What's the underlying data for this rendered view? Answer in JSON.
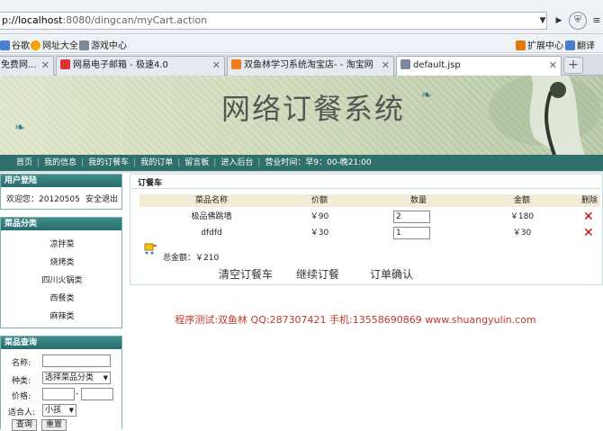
{
  "browser": {
    "address": {
      "prefix": "p://",
      "host": "localhost",
      "rest": ":8080/dingcan/myCart.action"
    },
    "bookmarks": [
      {
        "label": "谷歌",
        "color": "#4a7fd0"
      },
      {
        "label": "网址大全",
        "color": "#f0a500"
      },
      {
        "label": "游戏中心",
        "color": "#7b8a99"
      },
      {
        "label": "扩展中心",
        "color": "#e07a10"
      },
      {
        "label": "翻译",
        "color": "#4a7fd0"
      }
    ],
    "tabs": [
      {
        "label": "免费网...",
        "color": "#5a9be0",
        "active": false
      },
      {
        "label": "网易电子邮箱 - 极速4.0",
        "color": "#d33",
        "active": false
      },
      {
        "label": "双鱼林学习系统淘宝店- - 淘宝网",
        "color": "#f37b1d",
        "active": false
      },
      {
        "label": "default.jsp",
        "color": "#7a8a9a",
        "active": true
      }
    ]
  },
  "banner": {
    "title": "网络订餐系统"
  },
  "nav": {
    "items": [
      "首页",
      "我的信息",
      "我的订餐车",
      "我的订单",
      "留言板",
      "进入后台"
    ],
    "hours": "营业时间：早9：00-晚21:00"
  },
  "sidebar": {
    "login": {
      "title": "用户登陆",
      "welcome": "欢迎您：20120505",
      "logout": "安全退出"
    },
    "categories": {
      "title": "菜品分类",
      "items": [
        "凉拌菜",
        "烧烤类",
        "四川火锅类",
        "西餐类",
        "麻辣类"
      ]
    },
    "query": {
      "title": "菜品查询",
      "name_label": "名称:",
      "type_label": "种类:",
      "type_value": "选择菜品分类",
      "price_label": "价格:",
      "price_sep": "-",
      "audience_label": "适合人:",
      "audience_value": "小孩",
      "search_button": "查询",
      "reset_button": "重置"
    }
  },
  "cart": {
    "title": "订餐车",
    "headers": {
      "name": "菜品名称",
      "price": "价额",
      "qty": "数量",
      "amount": "金额",
      "del": "删除"
    },
    "rows": [
      {
        "name": "极品佛跳墙",
        "price": "￥90",
        "qty": "2",
        "amount": "￥180"
      },
      {
        "name": "dfdfd",
        "price": "￥30",
        "qty": "1",
        "amount": "￥30"
      }
    ],
    "total": "总金额：￥210",
    "actions": {
      "clear": "清空订餐车",
      "continue": "继续订餐",
      "confirm": "订单确认"
    }
  },
  "footer": {
    "text": "程序测试:双鱼林 QQ:287307421 手机:13558690869 www.shuangyulin.com"
  }
}
